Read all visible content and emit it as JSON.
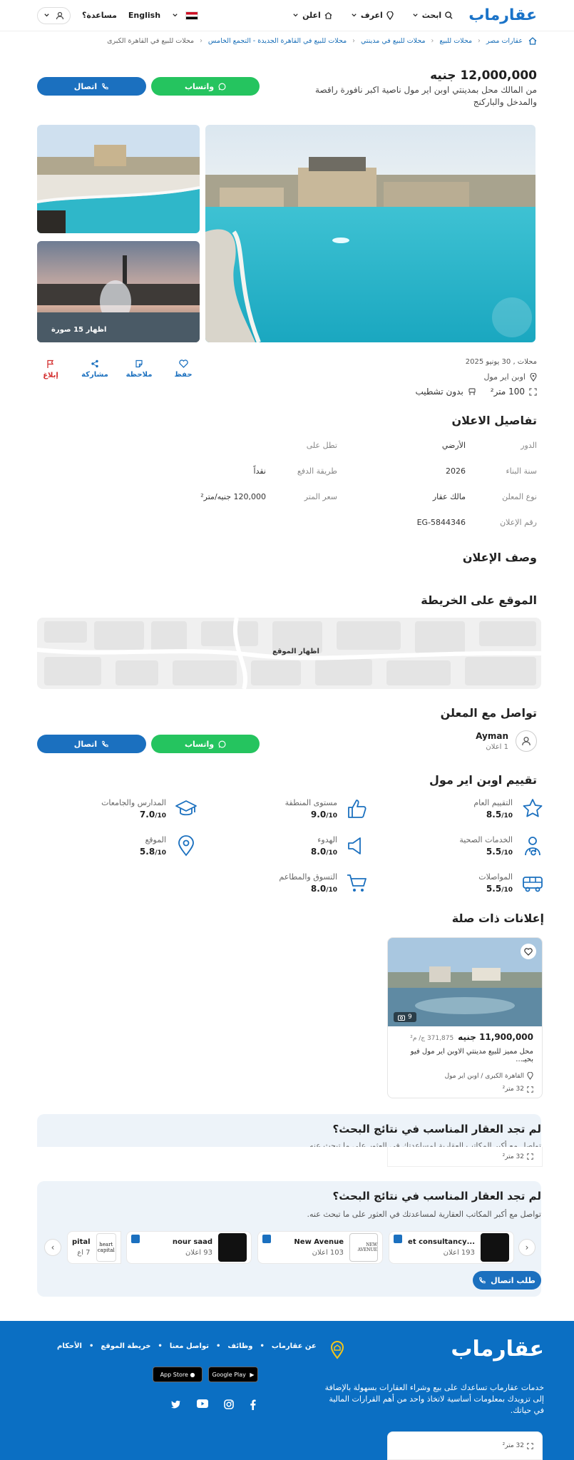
{
  "header": {
    "logo": "عقارماب",
    "nav": [
      "ابحث",
      "اعرف",
      "اعلن"
    ],
    "language": "English",
    "help": "مساعدة؟"
  },
  "breadcrumb": [
    "عقارات مصر",
    "محلات للبيع",
    "محلات للبيع في مدينتي",
    "محلات للبيع في القاهرة الجديدة - التجمع الخامس",
    "محلات للبيع في القاهرة الكبرى"
  ],
  "listing": {
    "price": "12,000,000 جنيه",
    "title": "من المالك محل بمدينتي اوبن اير مول ناصية اكبر نافورة راقصة والمدخل والباركنج",
    "whatsapp": "واتساب",
    "call": "اتصال",
    "photos_count": "اظهار 15 صورة",
    "meta_date": "محلات , 30 يونيو 2025",
    "location": "اوبن اير مول",
    "area": "100 متر²",
    "finishing": "بدون تشطيب"
  },
  "actions": {
    "save": "حفظ",
    "note": "ملاحظة",
    "share": "مشاركة",
    "report": "إبلاغ"
  },
  "details": {
    "title": "تفاصيل الاعلان",
    "rows": [
      {
        "k1": "الدور",
        "v1": "الأرضي",
        "k2": "تطل على",
        "v2": ""
      },
      {
        "k1": "سنة البناء",
        "v1": "2026",
        "k2": "طريقة الدفع",
        "v2": "نقداً"
      },
      {
        "k1": "نوع المعلن",
        "v1": "مالك عقار",
        "k2": "سعر المتر",
        "v2": "120,000 جنيه/متر²"
      },
      {
        "k1": "رقم الإعلان",
        "v1": "EG-5844346",
        "k2": "",
        "v2": ""
      }
    ]
  },
  "description_title": "وصف الإعلان",
  "map": {
    "title": "الموقع على الخريطة",
    "show": "اظهار الموقع"
  },
  "contact": {
    "title": "تواصل مع المعلن",
    "name": "Ayman",
    "count": "1 اعلان",
    "whatsapp": "واتساب",
    "call": "اتصال"
  },
  "ratings": {
    "title": "تقييم اوبن اير مول",
    "items": [
      {
        "label": "التقييم العام",
        "score": "8.5",
        "icon": "star-icon"
      },
      {
        "label": "مستوى المنطقة",
        "score": "9.0",
        "icon": "thumbs-up-icon"
      },
      {
        "label": "المدارس والجامعات",
        "score": "7.0",
        "icon": "graduation-cap-icon"
      },
      {
        "label": "الخدمات الصحية",
        "score": "5.5",
        "icon": "doctor-icon"
      },
      {
        "label": "الهدوء",
        "score": "8.0",
        "icon": "speaker-icon"
      },
      {
        "label": "الموقع",
        "score": "5.8",
        "icon": "pin-icon"
      },
      {
        "label": "المواصلات",
        "score": "5.5",
        "icon": "bus-icon"
      },
      {
        "label": "التسوق والمطاعم",
        "score": "8.0",
        "icon": "cart-icon"
      }
    ],
    "out_of": "/10"
  },
  "related": {
    "title": "إعلانات ذات صلة",
    "card": {
      "photos": "9",
      "price": "11,900,000 جنيه",
      "per_meter": "371,875 ج/ م²",
      "title": "محل مميز للبيع مدينتي الاوبن اير مول فيو بحيـ...",
      "location": "القاهرة الكبرى / اوبن اير مول",
      "area": "32 متر²"
    }
  },
  "banner_partial": {
    "title": "لم تجد العقار المناسب في نتائج البحث؟",
    "sub": "تواصل مع أكبر المكاتب العقارية لمساعدتك في العثور على ما تبحث عنه.",
    "area": "32 متر²"
  },
  "banner": {
    "title": "لم تجد العقار المناسب في نتائج البحث؟",
    "sub": "تواصل مع أكبر المكاتب العقارية لمساعدتك في العثور على ما تبحث عنه.",
    "request": "طلب اتصال",
    "agencies": [
      {
        "name": "...et consultancy",
        "count": "193 اعلان"
      },
      {
        "name": "New Avenue",
        "count": "103 اعلان"
      },
      {
        "name": "nour saad",
        "count": "93 اعلان"
      },
      {
        "name": "pital",
        "count": "7 اع"
      }
    ],
    "agency_logo_text": "NEW AVENUE",
    "agency_logo_text2": "heart capital"
  },
  "footer": {
    "logo": "عقارماب",
    "about": "خدمات عقارماب تساعدك على بيع وشراء العقارات بسهولة بالإضافة إلى تزويدك بمعلومات أساسية لاتخاذ واحد من أهم القرارات المالية في حياتك.",
    "links": [
      "عن عقارماب",
      "وظائف",
      "تواصل معنا",
      "خريطة الموقع",
      "الأحكام"
    ],
    "app_store": "App Store",
    "google_play": "Google Play",
    "area": "32 متر²"
  }
}
